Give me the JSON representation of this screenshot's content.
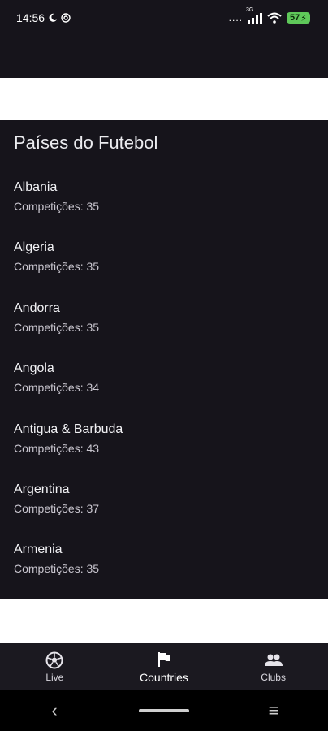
{
  "status_bar": {
    "time": "14:56",
    "dots": "....",
    "network_tag": "3G",
    "battery": "57"
  },
  "page": {
    "title": "Países do Futebol"
  },
  "countries": [
    {
      "name": "Albania",
      "competitions": "Competições: 35"
    },
    {
      "name": "Algeria",
      "competitions": "Competições: 35"
    },
    {
      "name": "Andorra",
      "competitions": "Competições: 35"
    },
    {
      "name": "Angola",
      "competitions": "Competições: 34"
    },
    {
      "name": "Antigua & Barbuda",
      "competitions": "Competições: 43"
    },
    {
      "name": "Argentina",
      "competitions": "Competições: 37"
    },
    {
      "name": "Armenia",
      "competitions": "Competições: 35"
    }
  ],
  "bottom_nav": {
    "items": [
      {
        "label": "Live",
        "icon": "soccer-ball-icon"
      },
      {
        "label": "Countries",
        "icon": "flag-icon",
        "active": true
      },
      {
        "label": "Clubs",
        "icon": "people-icon"
      }
    ]
  },
  "system_nav": {
    "back": "‹",
    "menu": "≡"
  },
  "colors": {
    "background": "#16141b",
    "banner": "#ffffff",
    "nav_bar": "#1b1920",
    "battery": "#5fc85a"
  }
}
